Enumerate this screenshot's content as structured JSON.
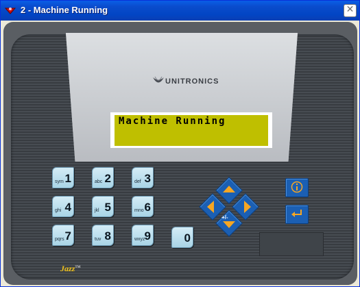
{
  "window": {
    "title": "2 - Machine Running",
    "close_label": "✕"
  },
  "device": {
    "logo": "UNITRONICS",
    "brand": "Jazz",
    "brand_mark": "TM",
    "lcd_text": "Machine Running"
  },
  "keypad": [
    {
      "sub": "sym",
      "main": "1"
    },
    {
      "sub": "abc",
      "main": "2"
    },
    {
      "sub": "def",
      "main": "3"
    },
    {
      "sub": "ghi",
      "main": "4"
    },
    {
      "sub": "jkl",
      "main": "5"
    },
    {
      "sub": "mno",
      "main": "6"
    },
    {
      "sub": "pqrs",
      "main": "7"
    },
    {
      "sub": "tuv",
      "main": "8"
    },
    {
      "sub": "wxyz",
      "main": "9"
    },
    {
      "sub": "",
      "main": "0"
    }
  ],
  "nav": {
    "center_symbol": "+/-"
  },
  "colors": {
    "lcd": "#bfbf00",
    "key_blue": "#1b5fb3",
    "arrow": "#f5a623",
    "key_face": "#bfe1f0",
    "titlebar": "#0a4ccc"
  },
  "icons": [
    "app-icon",
    "close-icon",
    "info-icon",
    "enter-icon",
    "up-arrow-icon",
    "down-arrow-icon",
    "left-arrow-icon",
    "right-arrow-icon",
    "unitronics-logo-icon"
  ]
}
